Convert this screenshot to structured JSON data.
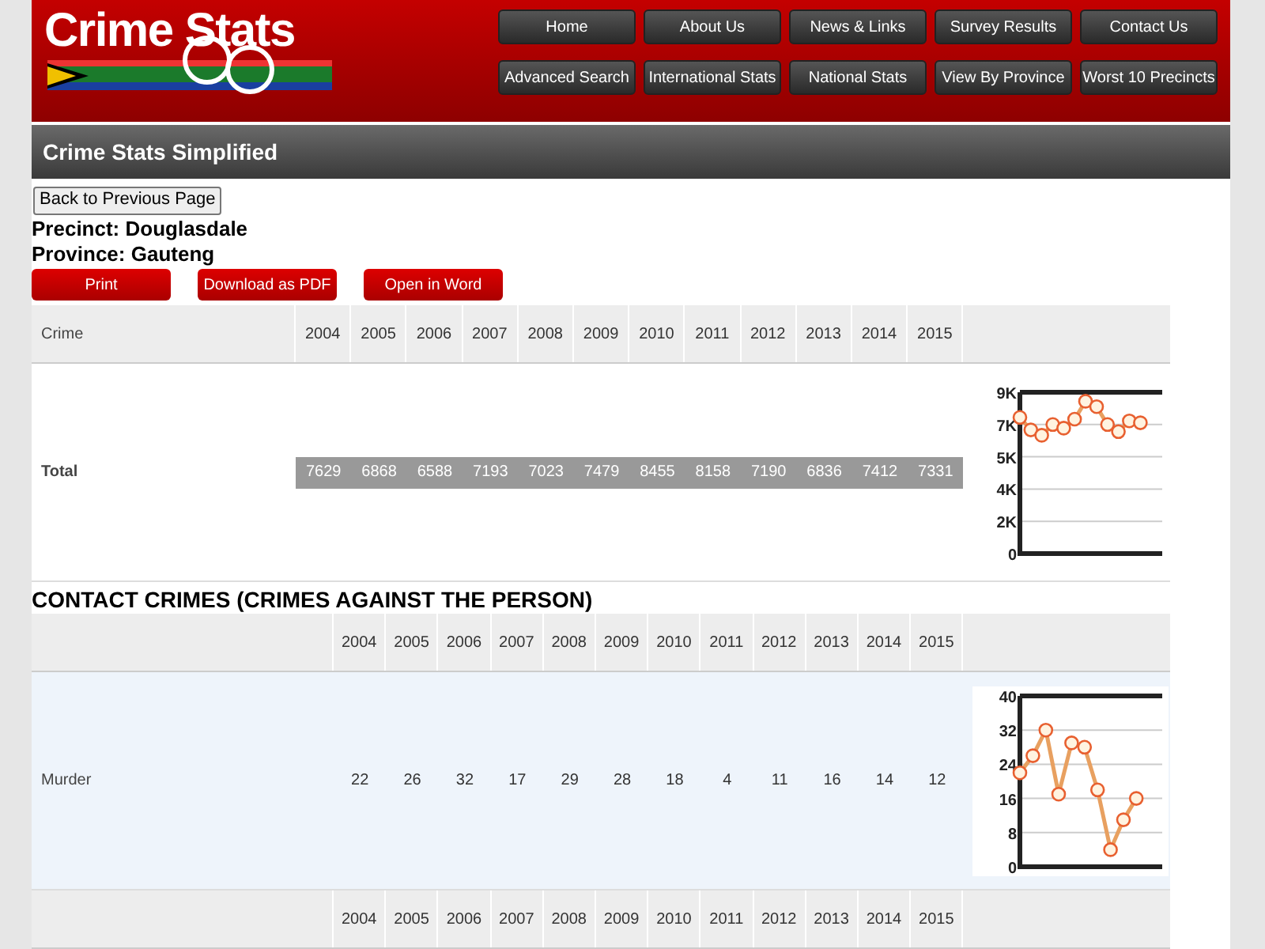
{
  "header": {
    "logo": "Crime Stats",
    "nav_rows": [
      [
        "Home",
        "About Us",
        "News & Links",
        "Survey Results",
        "Contact Us"
      ],
      [
        "Advanced Search",
        "International Stats",
        "National Stats",
        "View By Province",
        "Worst 10 Precincts"
      ]
    ]
  },
  "title_bar": "Crime Stats Simplified",
  "back_button": "Back to Previous Page",
  "precinct": "Precinct: Douglasdale",
  "province": "Province: Gauteng",
  "actions": [
    "Print",
    "Download as PDF",
    "Open in Word"
  ],
  "sections": [
    {
      "first_column": "Crime",
      "years": [
        "2004",
        "2005",
        "2006",
        "2007",
        "2008",
        "2009",
        "2010",
        "2011",
        "2012",
        "2013",
        "2014",
        "2015"
      ],
      "rows": [
        {
          "kind": "total",
          "name": "Total",
          "values": [
            "7629",
            "6868",
            "6588",
            "7193",
            "7023",
            "7479",
            "8455",
            "8158",
            "7190",
            "6836",
            "7412",
            "7331"
          ],
          "chart_data": {
            "type": "line",
            "ylim": [
              0,
              9000
            ],
            "grid": true,
            "yticks": [
              {
                "value": 0,
                "label": "0"
              },
              {
                "value": 1800,
                "label": "2K"
              },
              {
                "value": 3600,
                "label": "4K"
              },
              {
                "value": 5400,
                "label": "5K"
              },
              {
                "value": 7200,
                "label": "7K"
              },
              {
                "value": 9000,
                "label": "9K"
              }
            ],
            "series": [
              {
                "color": "#e8a060",
                "marker": "circle",
                "values": [
                  7600,
                  6900,
                  6600,
                  7200,
                  7000,
                  7500,
                  8500,
                  8200,
                  7200,
                  6800,
                  7400,
                  7300
                ]
              }
            ]
          }
        }
      ]
    },
    {
      "heading": "CONTACT CRIMES (CRIMES AGAINST THE PERSON)",
      "years": [
        "2004",
        "2005",
        "2006",
        "2007",
        "2008",
        "2009",
        "2010",
        "2011",
        "2012",
        "2013",
        "2014",
        "2015"
      ],
      "rows": [
        {
          "kind": "crime",
          "name": "Murder",
          "values": [
            "22",
            "26",
            "32",
            "17",
            "29",
            "28",
            "18",
            "4",
            "11",
            "16",
            "14",
            "12"
          ],
          "chart_data": {
            "type": "line",
            "ylim": [
              0,
              40
            ],
            "grid": true,
            "yticks": [
              0,
              8,
              16,
              24,
              32,
              40
            ],
            "series": [
              {
                "color": "#e8a060",
                "marker": "circle",
                "values": [
                  22,
                  26,
                  32,
                  17,
                  29,
                  28,
                  18,
                  4,
                  11,
                  16
                ]
              }
            ]
          }
        }
      ]
    },
    {
      "years": [
        "2004",
        "2005",
        "2006",
        "2007",
        "2008",
        "2009",
        "2010",
        "2011",
        "2012",
        "2013",
        "2014",
        "2015"
      ]
    }
  ]
}
